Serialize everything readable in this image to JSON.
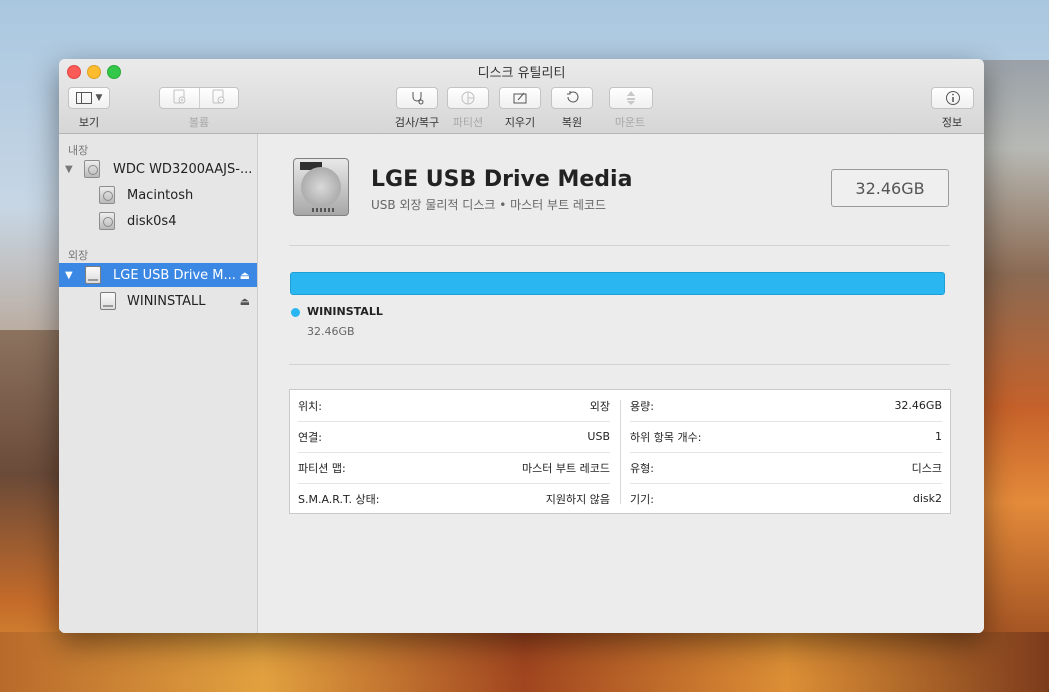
{
  "window": {
    "title": "디스크 유틸리티"
  },
  "toolbar": {
    "view_label": "보기",
    "volume_label": "볼륨",
    "first_aid_label": "검사/복구",
    "partition_label": "파티션",
    "erase_label": "지우기",
    "restore_label": "복원",
    "mount_label": "마운트",
    "info_label": "정보",
    "icons": {
      "view": "sidebar-icon",
      "add_volume": "add-volume-icon",
      "remove_volume": "remove-volume-icon",
      "first_aid": "stethoscope-icon",
      "partition": "pie-icon",
      "erase": "eraser-icon",
      "restore": "restore-icon",
      "mount": "mount-icon",
      "info": "info-icon"
    }
  },
  "sidebar": {
    "internal_label": "내장",
    "external_label": "외장",
    "internal_items": [
      {
        "label": "WDC WD3200AAJS-...",
        "level": 0
      },
      {
        "label": "Macintosh",
        "level": 1
      },
      {
        "label": "disk0s4",
        "level": 1
      }
    ],
    "external_items": [
      {
        "label": "LGE USB Drive M...",
        "level": 0,
        "selected": true
      },
      {
        "label": "WININSTALL",
        "level": 1
      }
    ]
  },
  "detail": {
    "name": "LGE USB Drive Media",
    "subtitle": "USB 외장 물리적 디스크 • 마스터 부트 레코드",
    "capacity": "32.46GB",
    "bar_color": "#2ab7f1",
    "partition": {
      "name": "WININSTALL",
      "size": "32.46GB",
      "fraction": 1.0
    }
  },
  "info": {
    "left": [
      {
        "key": "위치:",
        "value": "외장"
      },
      {
        "key": "연결:",
        "value": "USB"
      },
      {
        "key": "파티션 맵:",
        "value": "마스터 부트 레코드"
      },
      {
        "key": "S.M.A.R.T. 상태:",
        "value": "지원하지 않음"
      }
    ],
    "right": [
      {
        "key": "용량:",
        "value": "32.46GB"
      },
      {
        "key": "하위 항목 개수:",
        "value": "1"
      },
      {
        "key": "유형:",
        "value": "디스크"
      },
      {
        "key": "기기:",
        "value": "disk2"
      }
    ]
  }
}
